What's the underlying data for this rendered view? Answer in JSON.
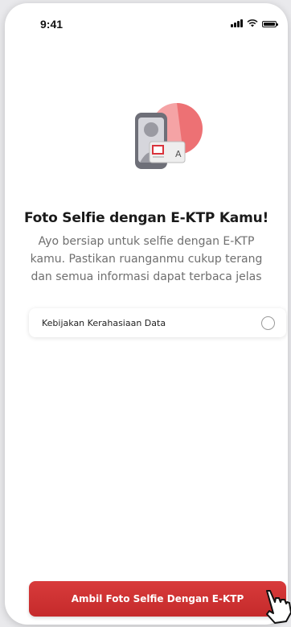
{
  "status_bar": {
    "time": "9:41",
    "icons": [
      "signal-icon",
      "wifi-icon",
      "battery-icon"
    ]
  },
  "illustration": {
    "icon": "selfie-ektp-illustration",
    "colors": {
      "accent": "#d9333b",
      "blob": "#f39a9c",
      "phone": "#6f6f78",
      "card": "#e7e7e7"
    }
  },
  "content": {
    "title": "Foto Selfie dengan E-KTP Kamu!",
    "description": "Ayo bersiap untuk selfie dengan E-KTP kamu. Pastikan ruanganmu cukup terang dan semua informasi dapat terbaca jelas"
  },
  "policy": {
    "label": "Kebijakan Kerahasiaan Data",
    "checked": false
  },
  "cta": {
    "label": "Ambil Foto Selfie Dengan E-KTP",
    "color": "#cf3031"
  },
  "cursor": {
    "icon": "hand-pointer-icon"
  }
}
